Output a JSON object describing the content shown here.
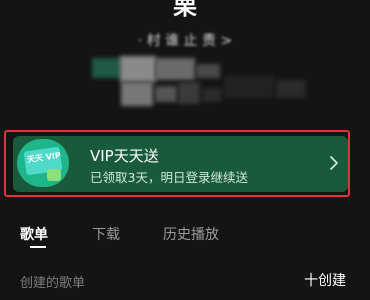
{
  "profile": {
    "name": "栗",
    "sub_info": "· 村 谁 止 责 >"
  },
  "vip_card": {
    "title": "VIP天天送",
    "subtitle": "已领取3天，明日登录继续送",
    "badge_text": "天天 VIP",
    "accent_color": "#1a5a3c",
    "highlight_color": "#e0343a",
    "chevron_icon": "chevron-right-icon"
  },
  "tabs": [
    {
      "label": "歌单",
      "active": true
    },
    {
      "label": "下载",
      "active": false
    },
    {
      "label": "历史播放",
      "active": false
    }
  ],
  "section": {
    "label": "创建的歌单",
    "create_label": "十创建"
  }
}
